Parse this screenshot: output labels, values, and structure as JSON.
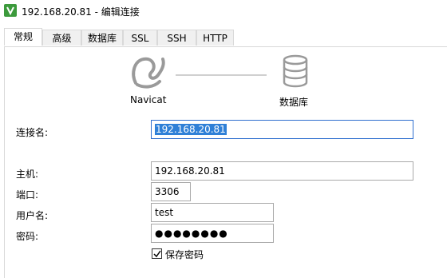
{
  "window": {
    "title": "192.168.20.81 - 编辑连接"
  },
  "tabs": [
    {
      "label": "常规",
      "active": true
    },
    {
      "label": "高级",
      "active": false
    },
    {
      "label": "数据库",
      "active": false
    },
    {
      "label": "SSL",
      "active": false
    },
    {
      "label": "SSH",
      "active": false
    },
    {
      "label": "HTTP",
      "active": false
    }
  ],
  "diagram": {
    "client_label": "Navicat",
    "server_label": "数据库",
    "client_icon": "navicat-icon",
    "server_icon": "database-icon"
  },
  "form": {
    "connection_name_label": "连接名:",
    "connection_name_value": "192.168.20.81",
    "host_label": "主机:",
    "host_value": "192.168.20.81",
    "port_label": "端口:",
    "port_value": "3306",
    "username_label": "用户名:",
    "username_value": "test",
    "password_label": "密码:",
    "password_value": "●●●●●●●●",
    "save_password_label": "保存密码",
    "save_password_checked": true
  },
  "colors": {
    "accent": "#2f80d7",
    "app_icon": "#3c9a3c"
  }
}
